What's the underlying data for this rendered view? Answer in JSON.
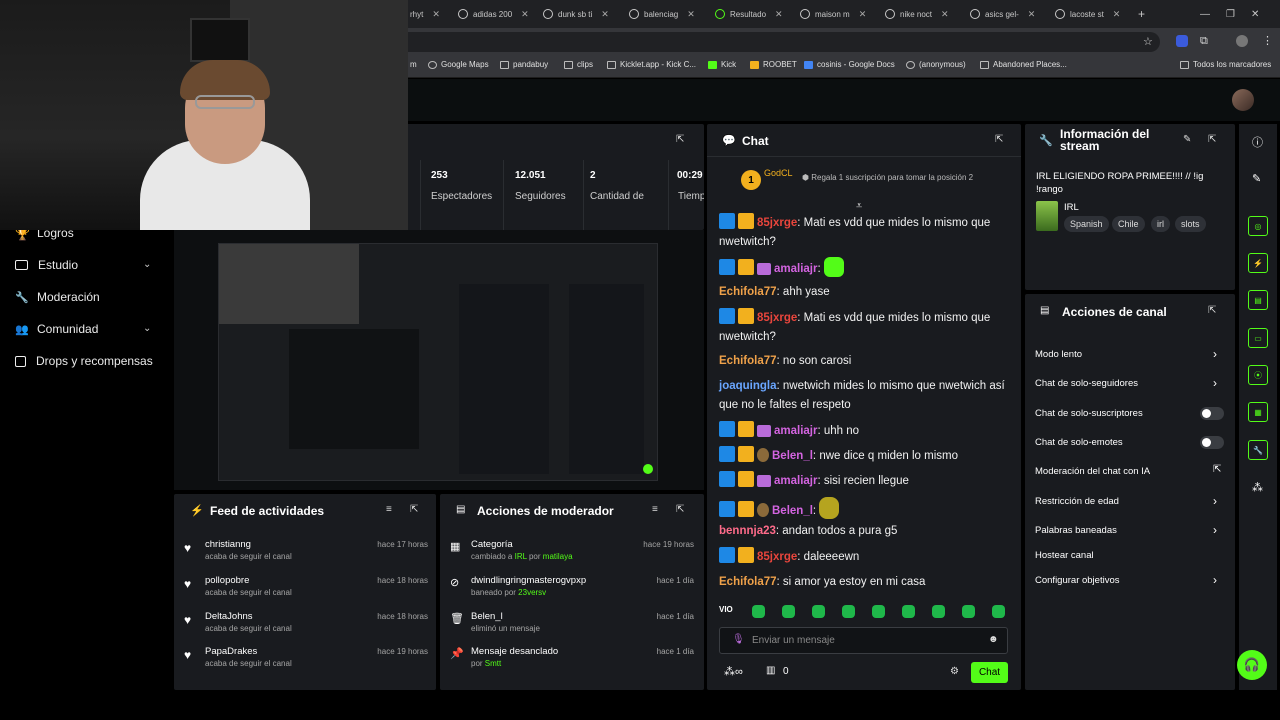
{
  "browser": {
    "tabs": [
      "rhyt",
      "adidas 200",
      "dunk sb ti",
      "balenciag",
      "Resultado",
      "maison m",
      "nike noct",
      "asics gel-",
      "lacoste st"
    ],
    "new_tab": "+",
    "bookmarks": [
      "m",
      "Google Maps",
      "pandabuy",
      "clips",
      "Kicklet.app - Kick C...",
      "Kick",
      "ROOBET",
      "cosinis - Google Docs",
      "(anonymous)",
      "Abandoned Places..."
    ],
    "all_bookmarks": "Todos los marcadores"
  },
  "sidebar": {
    "items": [
      {
        "label": "Logros"
      },
      {
        "label": "Estudio"
      },
      {
        "label": "Moderación"
      },
      {
        "label": "Comunidad"
      },
      {
        "label": "Drops y recompensas"
      }
    ]
  },
  "stats": [
    {
      "value": "253",
      "label": "Espectadores"
    },
    {
      "value": "12.051",
      "label": "Seguidores"
    },
    {
      "value": "2",
      "label": "Cantidad de"
    },
    {
      "value": "00:29",
      "label": "Tiemp"
    }
  ],
  "feed": {
    "title": "Feed de actividades",
    "items": [
      {
        "name": "christianng",
        "action": "acaba de seguir el canal",
        "time": "hace 17 horas"
      },
      {
        "name": "pollopobre",
        "action": "acaba de seguir el canal",
        "time": "hace 18 horas"
      },
      {
        "name": "DeltaJohns",
        "action": "acaba de seguir el canal",
        "time": "hace 18 horas"
      },
      {
        "name": "PapaDrakes",
        "action": "acaba de seguir el canal",
        "time": "hace 19 horas"
      }
    ]
  },
  "mod_actions": {
    "title": "Acciones de moderador",
    "items": [
      {
        "name": "Categoría",
        "sub": "cambiado a",
        "sub_hl": "IRL",
        "sub2": "por",
        "sub_user": "matilaya",
        "time": "hace 19 horas"
      },
      {
        "name": "dwindlingringmasterogvpxp",
        "sub": "baneado por",
        "sub_user": "23versv",
        "time": "hace 1 día"
      },
      {
        "name": "Belen_l",
        "sub": "eliminó un mensaje",
        "time": "hace 1 día"
      },
      {
        "name": "Mensaje desanclado",
        "sub": "por",
        "sub_user": "Smtt",
        "time": "hace 1 día"
      }
    ]
  },
  "chat": {
    "title": "Chat",
    "pinned_user": "GodCL",
    "pinned_rank": "1",
    "pinned_text": "Regala 1 suscripción para tomar la posición 2",
    "messages": [
      {
        "user": "85jxrge",
        "color": "#e8453c",
        "text": "Mati es vdd que mides lo mismo que nwetwitch?",
        "badges": [
          "mod",
          "vip"
        ]
      },
      {
        "user": "amaliajr",
        "color": "#d364e0",
        "text": "",
        "emote": true,
        "badges": [
          "mod",
          "vip",
          "sub"
        ]
      },
      {
        "user": "Echifola77",
        "color": "#f0a24a",
        "text": "ahh yase",
        "badges": []
      },
      {
        "user": "85jxrge",
        "color": "#e8453c",
        "text": "Mati es vdd que mides lo mismo que nwetwitch?",
        "badges": [
          "mod",
          "vip"
        ]
      },
      {
        "user": "Echifola77",
        "color": "#f0a24a",
        "text": "no son carosi",
        "badges": []
      },
      {
        "user": "joaquingla",
        "color": "#6aa6ff",
        "text": "nwetwich mides lo mismo que nwetwich así que no le faltes el respeto",
        "badges": []
      },
      {
        "user": "amaliajr",
        "color": "#d364e0",
        "text": "uhh no",
        "badges": [
          "mod",
          "vip",
          "sub"
        ]
      },
      {
        "user": "Belen_l",
        "color": "#d364e0",
        "text": "nwe dice q miden lo mismo",
        "badges": [
          "mod",
          "vip",
          "og"
        ]
      },
      {
        "user": "amaliajr",
        "color": "#d364e0",
        "text": "sisi recien llegue",
        "badges": [
          "mod",
          "vip",
          "sub"
        ]
      },
      {
        "user": "Belen_l",
        "color": "#d364e0",
        "text": "",
        "emote2": true,
        "badges": [
          "mod",
          "vip",
          "og"
        ]
      },
      {
        "user": "bennnja23",
        "color": "#ff6b8a",
        "text": "andan todos a pura g5",
        "badges": []
      },
      {
        "user": "85jxrge",
        "color": "#e8453c",
        "text": "daleeeewn",
        "badges": [
          "mod",
          "vip"
        ]
      },
      {
        "user": "Echifola77",
        "color": "#f0a24a",
        "text": "si amor ya estoy en mi casa",
        "badges": []
      }
    ],
    "input_placeholder": "Enviar un mensaje",
    "points": "0",
    "send_label": "Chat"
  },
  "info": {
    "title": "Información del stream",
    "stream_title": "IRL ELIGIENDO ROPA PRIMEE!!!! // !ig !rango",
    "category": "IRL",
    "tags": [
      "Spanish",
      "Chile",
      "irl",
      "slots"
    ]
  },
  "channel_actions": {
    "title": "Acciones de canal",
    "items": [
      {
        "label": "Modo lento",
        "control": "arrow"
      },
      {
        "label": "Chat de solo-seguidores",
        "control": "arrow"
      },
      {
        "label": "Chat de solo-suscriptores",
        "control": "toggle"
      },
      {
        "label": "Chat de solo-emotes",
        "control": "toggle"
      },
      {
        "label": "Moderación del chat con IA",
        "control": "external"
      },
      {
        "label": "Restricción de edad",
        "control": "arrow"
      },
      {
        "label": "Palabras baneadas",
        "control": "arrow"
      },
      {
        "label": "Hostear canal",
        "control": "none"
      },
      {
        "label": "Configurar objetivos",
        "control": "arrow"
      }
    ]
  },
  "colors": {
    "accent": "#53fc18",
    "panel": "#191b1f",
    "bg": "#0b0e0f"
  }
}
